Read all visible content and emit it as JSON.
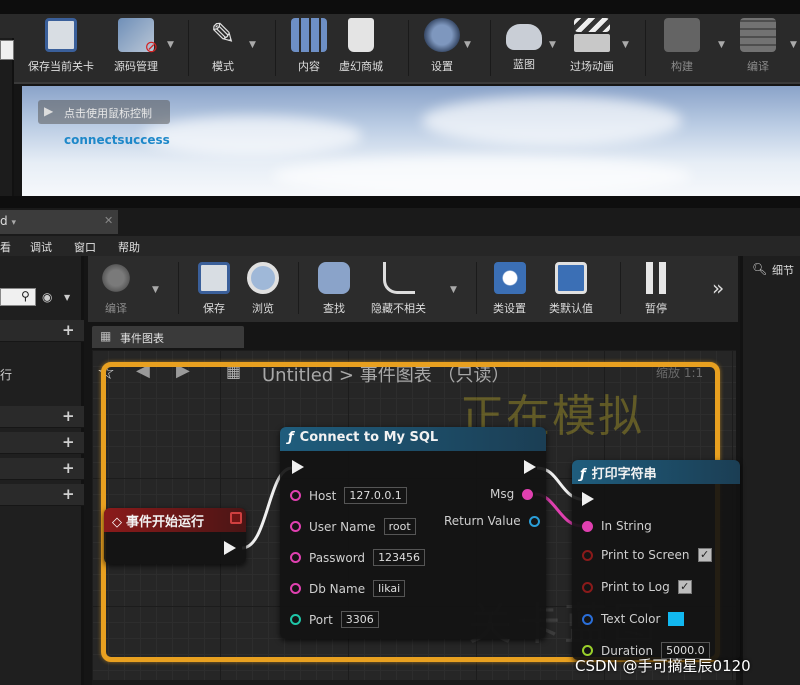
{
  "top_toolbar": {
    "buttons": [
      {
        "label": "保存当前关卡",
        "icon": "save-icon"
      },
      {
        "label": "源码管理",
        "icon": "source-control-icon"
      },
      {
        "label": "模式",
        "icon": "modes-icon"
      },
      {
        "label": "内容",
        "icon": "content-icon"
      },
      {
        "label": "虚幻商城",
        "icon": "marketplace-icon"
      },
      {
        "label": "设置",
        "icon": "settings-icon"
      },
      {
        "label": "蓝图",
        "icon": "blueprint-icon"
      },
      {
        "label": "过场动画",
        "icon": "cinematics-icon"
      },
      {
        "label": "构建",
        "icon": "build-icon"
      },
      {
        "label": "编译",
        "icon": "compile-icon"
      }
    ]
  },
  "viewport": {
    "hint": "点击使用鼠标控制",
    "message": "connectsuccess"
  },
  "blueprint_window": {
    "tab_title": "d",
    "menu": [
      "看",
      "调试",
      "窗口",
      "帮助"
    ],
    "left_panel_text": "行",
    "toolbar": [
      {
        "label": "编译",
        "icon": "compile-icon"
      },
      {
        "label": "保存",
        "icon": "save-icon"
      },
      {
        "label": "浏览",
        "icon": "browse-icon"
      },
      {
        "label": "查找",
        "icon": "find-icon"
      },
      {
        "label": "隐藏不相关",
        "icon": "hide-unrelated-icon"
      },
      {
        "label": "类设置",
        "icon": "class-settings-icon"
      },
      {
        "label": "类默认值",
        "icon": "class-defaults-icon"
      },
      {
        "label": "暂停",
        "icon": "pause-icon"
      }
    ],
    "details_label": "细节",
    "graph_tab": "事件图表",
    "breadcrumb": "Untitled > 事件图表 （只读）",
    "zoom_label": "缩放 1:1",
    "sim_watermark": "正在模拟",
    "level_watermark": "关卡蓝图"
  },
  "nodes": {
    "event_begin_play": {
      "title": "事件开始运行",
      "color": "#8b1a1a"
    },
    "connect_mysql": {
      "title": "Connect to My SQL",
      "color": "#1f5d7d",
      "inputs": [
        {
          "label": "Host",
          "value": "127.0.0.1"
        },
        {
          "label": "User Name",
          "value": "root"
        },
        {
          "label": "Password",
          "value": "123456"
        },
        {
          "label": "Db Name",
          "value": "likai"
        },
        {
          "label": "Port",
          "value": "3306"
        }
      ],
      "outputs": [
        {
          "label": "Msg"
        },
        {
          "label": "Return Value"
        }
      ]
    },
    "print_string": {
      "title": "打印字符串",
      "color": "#1f5d7d",
      "inputs": [
        {
          "label": "In String"
        },
        {
          "label": "Print to Screen",
          "checked": true
        },
        {
          "label": "Print to Log",
          "checked": true
        },
        {
          "label": "Text Color",
          "swatch": "#12b8f0"
        },
        {
          "label": "Duration",
          "value": "5000.0"
        }
      ]
    }
  },
  "watermark": "CSDN @手可摘星辰0120"
}
